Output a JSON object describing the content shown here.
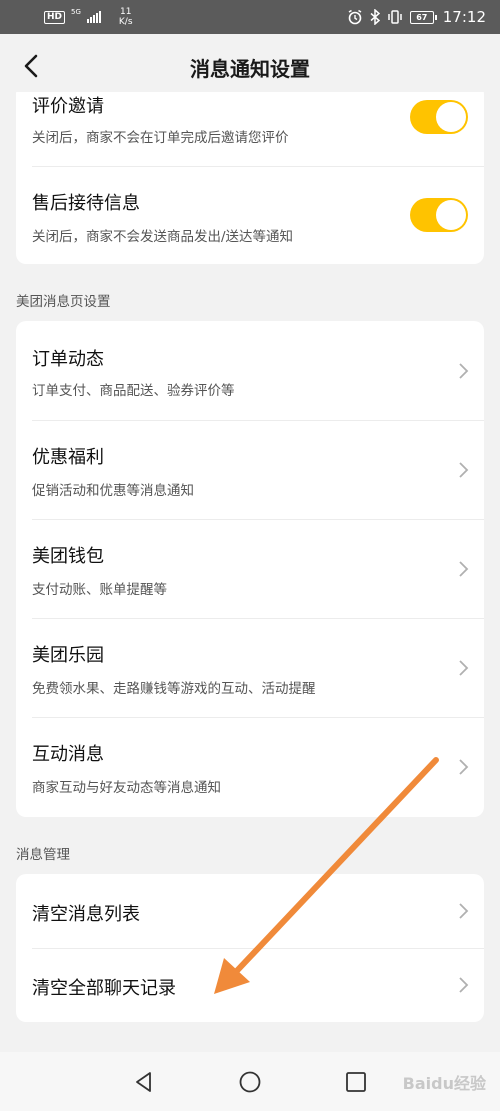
{
  "status_bar": {
    "hd": "HD",
    "net_type": "5G",
    "speed_value": "11",
    "speed_unit": "K/s",
    "battery": "67",
    "time": "17:12"
  },
  "header": {
    "title": "消息通知设置"
  },
  "card1": {
    "rows": [
      {
        "title": "评价邀请",
        "desc": "关闭后，商家不会在订单完成后邀请您评价",
        "toggle_on": true
      },
      {
        "title": "售后接待信息",
        "desc": "关闭后，商家不会发送商品发出/送达等通知",
        "toggle_on": true
      }
    ]
  },
  "section_meituan": {
    "label": "美团消息页设置"
  },
  "card2": {
    "rows": [
      {
        "title": "订单动态",
        "desc": "订单支付、商品配送、验券评价等"
      },
      {
        "title": "优惠福利",
        "desc": "促销活动和优惠等消息通知"
      },
      {
        "title": "美团钱包",
        "desc": "支付动账、账单提醒等"
      },
      {
        "title": "美团乐园",
        "desc": "免费领水果、走路赚钱等游戏的互动、活动提醒"
      },
      {
        "title": "互动消息",
        "desc": "商家互动与好友动态等消息通知"
      }
    ]
  },
  "section_manage": {
    "label": "消息管理"
  },
  "card3": {
    "rows": [
      {
        "title": "清空消息列表"
      },
      {
        "title": "清空全部聊天记录"
      }
    ]
  },
  "watermark": "Baidu经验",
  "colors": {
    "accent": "#ffc300",
    "annotation_arrow": "#f08a3a"
  },
  "icons": [
    "back-icon",
    "chevron-right-icon",
    "nav-back-icon",
    "nav-home-icon",
    "nav-recents-icon"
  ]
}
